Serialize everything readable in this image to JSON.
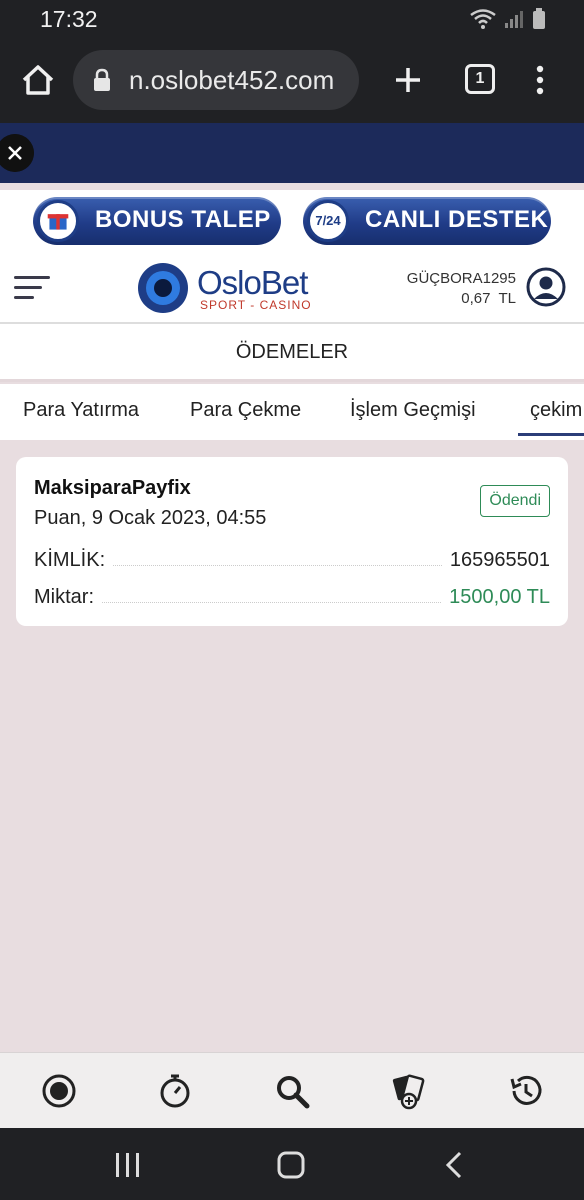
{
  "status_bar": {
    "time": "17:32"
  },
  "browser": {
    "url": "n.oslobet452.com",
    "tab_count": "1"
  },
  "promo": {
    "bonus_label": "BONUS TALEP",
    "support_label": "CANLI DESTEK",
    "support_badge": "7/24"
  },
  "header": {
    "logo_name": "OsloBet",
    "logo_tagline": "SPORT - CASINO",
    "username": "GÜÇBORA1295",
    "balance": "0,67  TL"
  },
  "page": {
    "title": "ÖDEMELER"
  },
  "tabs": [
    "Para Yatırma",
    "Para Çekme",
    "İşlem Geçmişi",
    "çekim"
  ],
  "transaction": {
    "provider": "MaksiparaPayfix",
    "date": "Puan, 9 Ocak 2023, 04:55",
    "status": "Ödendi",
    "id_label": "KİMLİK:",
    "id_value": "165965501",
    "amount_label": "Miktar:",
    "amount_value": "1500,00 TL"
  },
  "colors": {
    "navy": "#1c2a5a",
    "success": "#2e8b57",
    "page_bg": "#e8dde0"
  }
}
